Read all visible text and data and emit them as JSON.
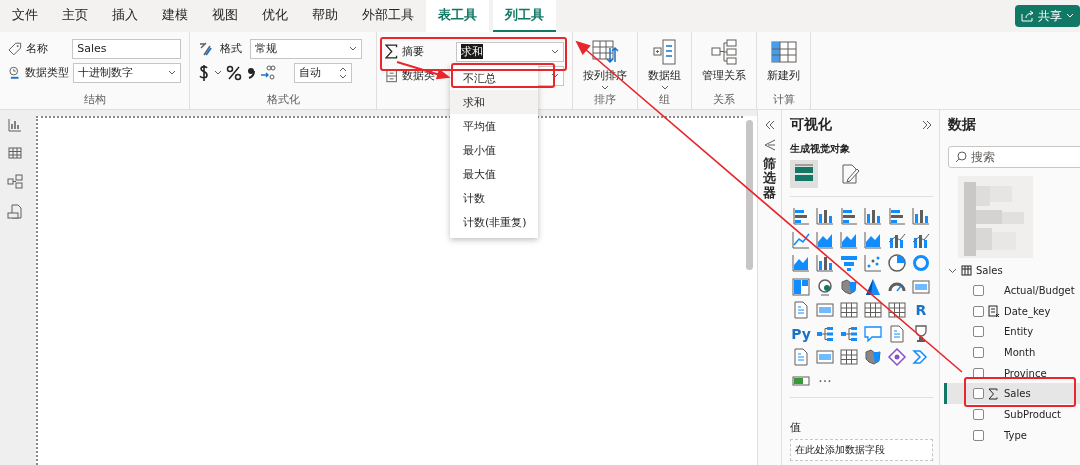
{
  "menu_tabs": [
    {
      "label": "文件",
      "kind": "plain",
      "selected": false
    },
    {
      "label": "主页",
      "kind": "plain",
      "selected": false
    },
    {
      "label": "插入",
      "kind": "plain",
      "selected": false
    },
    {
      "label": "建模",
      "kind": "plain",
      "selected": false
    },
    {
      "label": "视图",
      "kind": "plain",
      "selected": false
    },
    {
      "label": "优化",
      "kind": "plain",
      "selected": false
    },
    {
      "label": "帮助",
      "kind": "plain",
      "selected": false
    },
    {
      "label": "外部工具",
      "kind": "plain",
      "selected": false
    },
    {
      "label": "表工具",
      "kind": "context",
      "selected": false
    },
    {
      "label": "列工具",
      "kind": "context",
      "selected": true
    }
  ],
  "share_button": {
    "label": "共享"
  },
  "ribbon": {
    "structure": {
      "name_label": "名称",
      "name_value": "Sales",
      "type_label": "数据类型",
      "type_value": "十进制数字",
      "group_label": "结构"
    },
    "formatting": {
      "format_label": "格式",
      "format_value": "常规",
      "decimals_value": "自动",
      "group_label": "格式化"
    },
    "properties": {
      "summary_label": "摘要",
      "summary_value": "求和",
      "category_label": "数据类"
    },
    "commands": [
      {
        "kind": "sort",
        "label": "按列排序",
        "has_menu": true,
        "group_label": "排序"
      },
      {
        "kind": "groups",
        "label": "数据组",
        "has_menu": true,
        "group_label": "组"
      },
      {
        "kind": "relations",
        "label": "管理关系",
        "has_menu": false,
        "group_label": "关系"
      },
      {
        "kind": "newcol",
        "label": "新建列",
        "has_menu": false,
        "group_label": "计算"
      }
    ]
  },
  "summary_dropdown": {
    "options": [
      {
        "label": "不汇总",
        "selected": false
      },
      {
        "label": "求和",
        "selected": true
      },
      {
        "label": "平均值",
        "selected": false
      },
      {
        "label": "最小值",
        "selected": false
      },
      {
        "label": "最大值",
        "selected": false
      },
      {
        "label": "计数",
        "selected": false
      },
      {
        "label": "计数(非重复)",
        "selected": false
      }
    ]
  },
  "filters": {
    "label": "筛选器"
  },
  "visualizations": {
    "title": "可视化",
    "subtitle": "生成视觉对象",
    "view_tabs": [
      {
        "kind": "build",
        "selected": true
      },
      {
        "kind": "format",
        "selected": false
      }
    ],
    "visuals": [
      {
        "kind": "hbar"
      },
      {
        "kind": "vbar"
      },
      {
        "kind": "hbar"
      },
      {
        "kind": "vbar"
      },
      {
        "kind": "hbar"
      },
      {
        "kind": "vbar"
      },
      {
        "kind": "line"
      },
      {
        "kind": "area"
      },
      {
        "kind": "area"
      },
      {
        "kind": "area"
      },
      {
        "kind": "combo"
      },
      {
        "kind": "combo"
      },
      {
        "kind": "area"
      },
      {
        "kind": "vbar"
      },
      {
        "kind": "funnel"
      },
      {
        "kind": "scatter"
      },
      {
        "kind": "pie"
      },
      {
        "kind": "donut"
      },
      {
        "kind": "treemap"
      },
      {
        "kind": "globe"
      },
      {
        "kind": "map"
      },
      {
        "kind": "triangle"
      },
      {
        "kind": "gauge"
      },
      {
        "kind": "card"
      },
      {
        "kind": "doc"
      },
      {
        "kind": "card"
      },
      {
        "kind": "table"
      },
      {
        "kind": "table"
      },
      {
        "kind": "table"
      },
      {
        "kind": "text",
        "label": "R"
      },
      {
        "kind": "text",
        "label": "Py"
      },
      {
        "kind": "tree"
      },
      {
        "kind": "tree"
      },
      {
        "kind": "bubble"
      },
      {
        "kind": "doc"
      },
      {
        "kind": "trophy"
      },
      {
        "kind": "doc"
      },
      {
        "kind": "card"
      },
      {
        "kind": "table"
      },
      {
        "kind": "map"
      },
      {
        "kind": "diamond"
      },
      {
        "kind": "chevron"
      },
      {
        "kind": "slider"
      },
      {
        "kind": "more",
        "label": "···"
      }
    ],
    "well_label": "值",
    "well_placeholder": "在此处添加数据字段"
  },
  "data": {
    "title": "数据",
    "search": {
      "placeholder": "搜索"
    },
    "tables": [
      {
        "name": "Sales",
        "expanded": true,
        "fields": [
          {
            "name": "Actual/Budget",
            "kind": "plain",
            "checked": false,
            "selected": false
          },
          {
            "name": "Date_key",
            "kind": "calc",
            "checked": false,
            "selected": false
          },
          {
            "name": "Entity",
            "kind": "plain",
            "checked": false,
            "selected": false
          },
          {
            "name": "Month",
            "kind": "plain",
            "checked": false,
            "selected": false
          },
          {
            "name": "Province",
            "kind": "plain",
            "checked": false,
            "selected": false
          },
          {
            "name": "Sales",
            "kind": "sum",
            "checked": false,
            "selected": true
          },
          {
            "name": "SubProduct",
            "kind": "plain",
            "checked": false,
            "selected": false
          },
          {
            "name": "Type",
            "kind": "plain",
            "checked": false,
            "selected": false
          }
        ]
      }
    ]
  }
}
